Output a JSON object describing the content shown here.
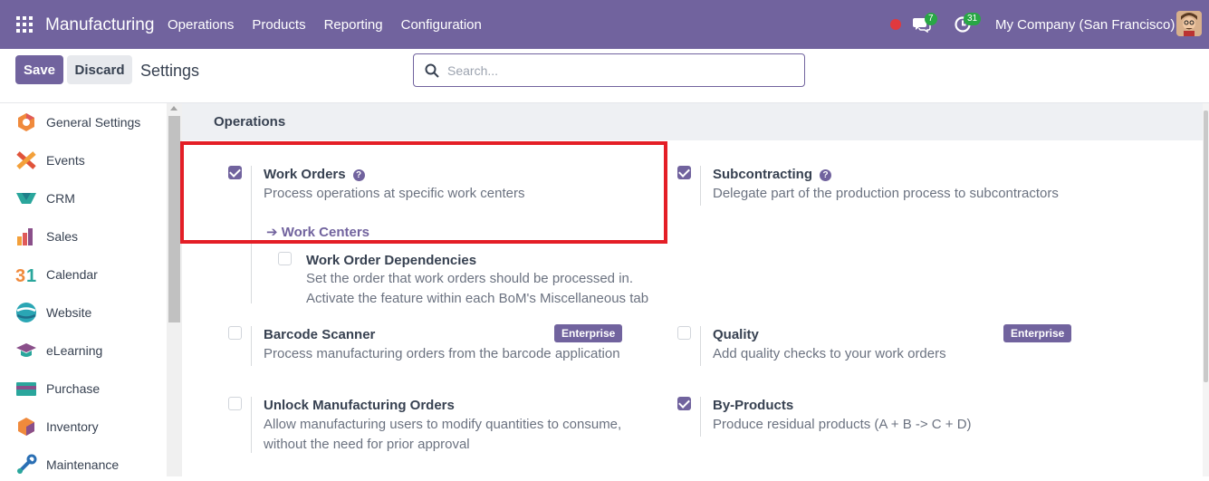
{
  "navbar": {
    "app_name": "Manufacturing",
    "menu": [
      "Operations",
      "Products",
      "Reporting",
      "Configuration"
    ],
    "messages_count": "7",
    "activities_count": "31",
    "company": "My Company (San Francisco)",
    "bg_color": "#71639e"
  },
  "control": {
    "save_label": "Save",
    "discard_label": "Discard",
    "title": "Settings",
    "search_placeholder": "Search..."
  },
  "sidebar": {
    "items": [
      {
        "label": "General Settings",
        "icon": "general-settings-icon"
      },
      {
        "label": "Events",
        "icon": "events-icon"
      },
      {
        "label": "CRM",
        "icon": "crm-icon"
      },
      {
        "label": "Sales",
        "icon": "sales-icon"
      },
      {
        "label": "Calendar",
        "icon": "calendar-icon"
      },
      {
        "label": "Website",
        "icon": "website-icon"
      },
      {
        "label": "eLearning",
        "icon": "elearning-icon"
      },
      {
        "label": "Purchase",
        "icon": "purchase-icon"
      },
      {
        "label": "Inventory",
        "icon": "inventory-icon"
      },
      {
        "label": "Maintenance",
        "icon": "maintenance-icon"
      }
    ]
  },
  "main": {
    "section_title": "Operations",
    "work_orders": {
      "title": "Work Orders",
      "desc": "Process operations at specific work centers",
      "link": "Work Centers",
      "checked": true
    },
    "work_order_dependencies": {
      "title": "Work Order Dependencies",
      "desc1": "Set the order that work orders should be processed in.",
      "desc2": "Activate the feature within each BoM's Miscellaneous tab",
      "checked": false
    },
    "subcontracting": {
      "title": "Subcontracting",
      "desc": "Delegate part of the production process to subcontractors",
      "checked": true
    },
    "barcode_scanner": {
      "title": "Barcode Scanner",
      "desc": "Process manufacturing orders from the barcode application",
      "badge": "Enterprise",
      "checked": false
    },
    "quality": {
      "title": "Quality",
      "desc": "Add quality checks to your work orders",
      "badge": "Enterprise",
      "checked": false
    },
    "unlock_mo": {
      "title": "Unlock Manufacturing Orders",
      "desc1": "Allow manufacturing users to modify quantities to consume,",
      "desc2": "without the need for prior approval",
      "checked": false
    },
    "by_products": {
      "title": "By-Products",
      "desc": "Produce residual products (A + B -> C + D)",
      "checked": true
    }
  }
}
